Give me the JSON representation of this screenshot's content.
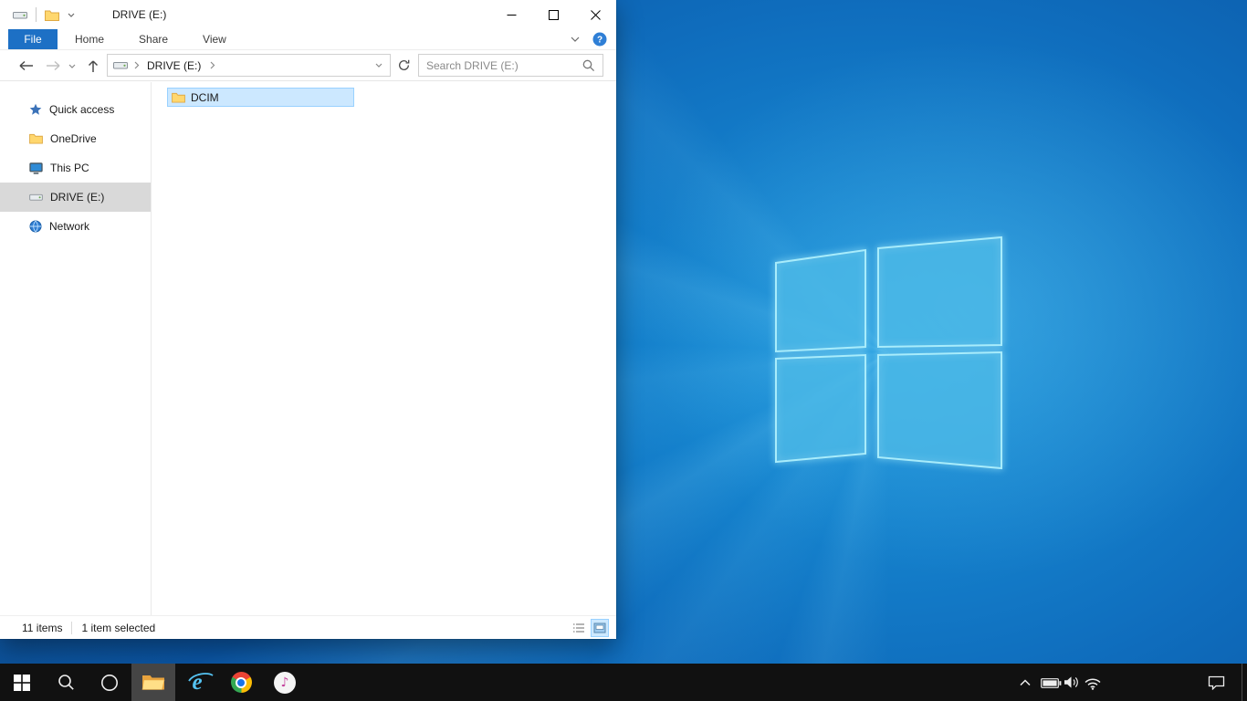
{
  "window": {
    "title": "DRIVE (E:)"
  },
  "ribbon": {
    "tabs": [
      {
        "label": "File"
      },
      {
        "label": "Home"
      },
      {
        "label": "Share"
      },
      {
        "label": "View"
      }
    ]
  },
  "navbar": {
    "breadcrumb_root": "DRIVE (E:)",
    "search_placeholder": "Search DRIVE (E:)"
  },
  "sidebar": {
    "items": [
      {
        "label": "Quick access",
        "icon": "star-icon",
        "selected": false
      },
      {
        "label": "OneDrive",
        "icon": "folder-icon",
        "selected": false
      },
      {
        "label": "This PC",
        "icon": "monitor-icon",
        "selected": false
      },
      {
        "label": "DRIVE (E:)",
        "icon": "drive-icon",
        "selected": true
      },
      {
        "label": "Network",
        "icon": "network-icon",
        "selected": false
      }
    ]
  },
  "content": {
    "items": [
      {
        "label": "DCIM",
        "type": "folder",
        "selected": true
      }
    ]
  },
  "statusbar": {
    "item_count": "11 items",
    "selection": "1 item selected"
  },
  "taskbar": {
    "buttons": [
      {
        "name": "start",
        "active": false
      },
      {
        "name": "search",
        "active": false
      },
      {
        "name": "cortana",
        "active": false
      },
      {
        "name": "file-explorer",
        "active": true
      },
      {
        "name": "internet-explorer",
        "active": false
      },
      {
        "name": "chrome",
        "active": false
      },
      {
        "name": "itunes",
        "active": false
      }
    ],
    "tray": [
      {
        "name": "hidden-icons-chevron"
      },
      {
        "name": "battery"
      },
      {
        "name": "volume"
      },
      {
        "name": "network"
      },
      {
        "name": "action-center"
      }
    ]
  },
  "colors": {
    "file_tab_blue": "#1d70c5",
    "selection_fill": "#cce8ff",
    "selection_border": "#99d1ff",
    "sidebar_selected": "#d9d9d9",
    "wallpaper_base": "#0f6dbd",
    "taskbar_bg": "#111111"
  }
}
